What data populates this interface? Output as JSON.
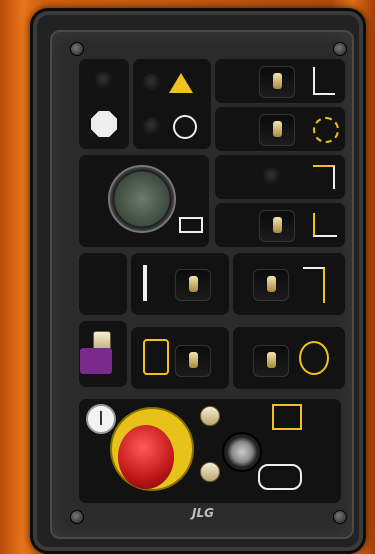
{
  "photo": {
    "subject": "",
    "brand_label": "JLG",
    "colors": {
      "housing_orange": "#d2600e",
      "panel_black": "#121212",
      "warning_yellow": "#f1c21b",
      "estop_red": "#c01616",
      "lock_purple": "#7a2a8a"
    },
    "icons": [
      "warning-triangle-icon",
      "engine-icon",
      "hour-meter-gauge",
      "battery-icon",
      "jib-lift-icon",
      "platform-rotate-icon",
      "boom-telescope-icon",
      "drive-enable-icon",
      "emergency-stop-button",
      "power-icon",
      "key-switch",
      "lock-icon"
    ]
  }
}
